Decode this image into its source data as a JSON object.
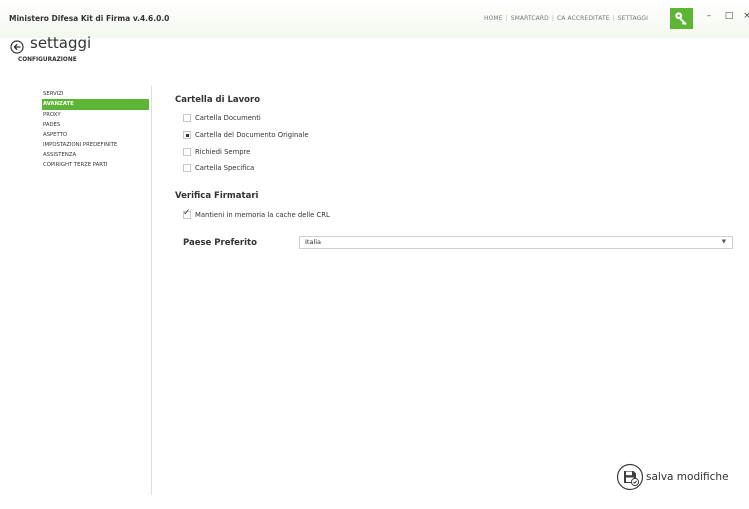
{
  "window": {
    "title": "Ministero Difesa Kit di Firma v.4.6.0.0",
    "nav": [
      "HOME",
      "SMARTCARD",
      "CA ACCREDITATE",
      "SETTAGGI"
    ],
    "minimize": "–",
    "maximize": "□",
    "close": "×"
  },
  "page": {
    "title": "settaggi",
    "section": "CONFIGURAZIONE"
  },
  "sidebar": {
    "items": [
      "SERVIZI",
      "AVANZATE",
      "PROXY",
      "PADES",
      "ASPETTO",
      "IMPOSTAZIONI PREDEFINITE",
      "ASSISTENZA",
      "COPIRIGHT TERZE PARTI"
    ],
    "active": "AVANZATE"
  },
  "cartella": {
    "heading": "Cartella di Lavoro",
    "options": [
      "Cartella Documenti",
      "Cartella del Documento Originale",
      "Richiedi Sempre",
      "Cartella Specifica"
    ],
    "selected": "Cartella del Documento Originale"
  },
  "verifica": {
    "heading": "Verifica Firmatari",
    "cache_label": "Mantieni in memoria la cache delle CRL",
    "cache_checked": true
  },
  "paese": {
    "label": "Paese Preferito",
    "value": "Italia"
  },
  "save": {
    "label": "salva modifiche"
  },
  "colors": {
    "accent": "#5db535"
  },
  "icons": {
    "tools": "key-icon",
    "back": "back-arrow-icon",
    "save": "floppy-disk-icon",
    "dropdown": "chevron-down-icon"
  }
}
